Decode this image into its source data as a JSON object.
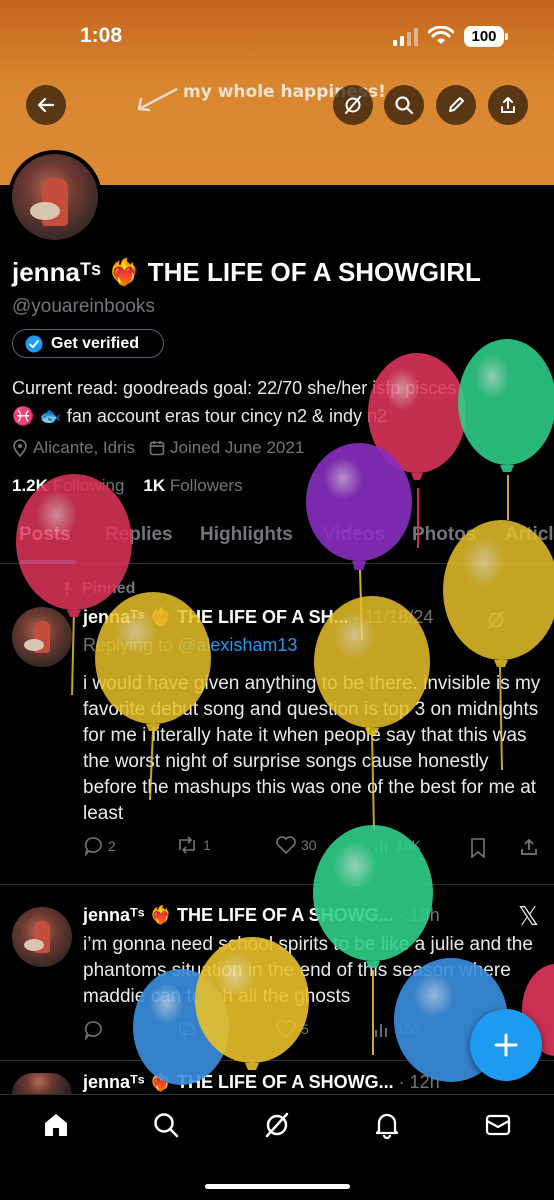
{
  "status_bar": {
    "time": "1:08",
    "battery": "100"
  },
  "banner": {
    "text": "my whole happiness!"
  },
  "profile": {
    "name": "jennaᵀˢ ❤️‍🔥 THE LIFE OF A SHOWGIRL",
    "handle": "@youareinbooks",
    "get_verified": "Get verified",
    "bio_line1": "Current read: goodreads goal: 22/70 she/her isfp pisces",
    "bio_line2": "♓ 🐟 fan account eras tour cincy n2 & indy n2",
    "location": "Alicante, Idris",
    "joined": "Joined June 2021",
    "following_count": "1.2K",
    "following_label": "Following",
    "followers_count": "1K",
    "followers_label": "Followers"
  },
  "tabs": [
    "Posts",
    "Replies",
    "Highlights",
    "Videos",
    "Photos",
    "Articles"
  ],
  "pinned_label": "Pinned",
  "tweets": [
    {
      "name": "jennaᵀˢ ❤️‍🔥 THE LIFE OF A SH...",
      "time": "· 11/18/24",
      "reply_prefix": "Replying to ",
      "reply_to": "@alexisham13",
      "text": "i would have given anything to be there. invisible is my favorite debut song and question is top 3 on midnights for me i literally hate it when people say that this was the worst night of surprise songs cause honestly before the mashups this was one of the best for me at least",
      "replies": "2",
      "retweets": "1",
      "likes": "30",
      "views": "19K"
    },
    {
      "name": "jennaᵀˢ ❤️‍🔥 THE LIFE OF A SHOWG...",
      "time": "· 13h",
      "text": "i’m gonna need school spirits to be like a julie and the phantoms situation in the end of this season where maddie can touch all the ghosts",
      "replies": "",
      "retweets": "",
      "likes": "5",
      "views": "150"
    },
    {
      "name": "jennaᵀˢ ❤️‍🔥 THE LIFE OF A SHOWG...",
      "time": "· 12h"
    }
  ],
  "colors": {
    "accent": "#1d9bf0",
    "banner": "#d98630",
    "muted": "#71767b",
    "balloons": [
      "#e0355a",
      "#2fd08a",
      "#8a2fc0",
      "#e8c02a",
      "#3a8fe0"
    ]
  }
}
